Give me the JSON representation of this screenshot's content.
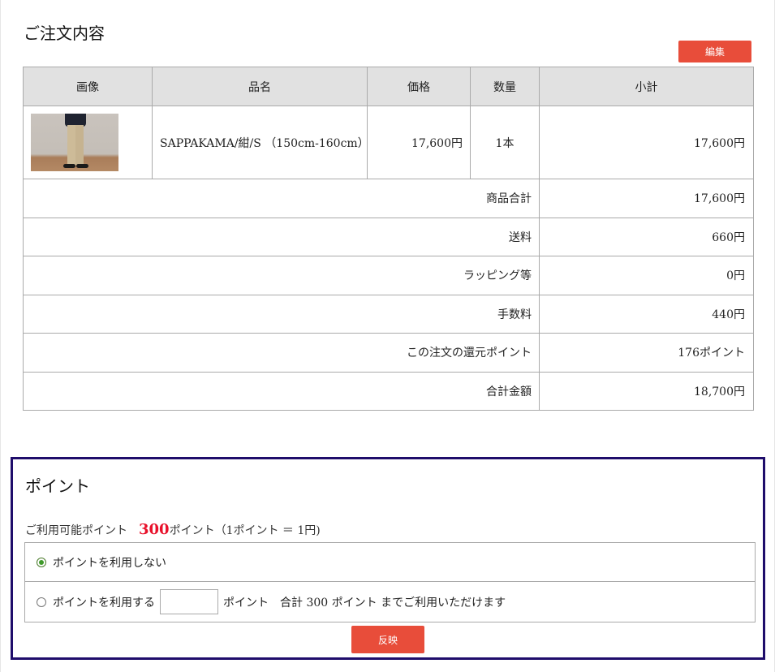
{
  "order": {
    "title": "ご注文内容",
    "edit_label": "編集",
    "headers": {
      "image": "画像",
      "name": "品名",
      "price": "価格",
      "qty": "数量",
      "subtotal": "小計"
    },
    "items": [
      {
        "name": "SAPPAKAMA/紺/S （150cm-160cm）",
        "price": "17,600円",
        "qty": "1本",
        "subtotal": "17,600円"
      }
    ],
    "summary": [
      {
        "label": "商品合計",
        "value": "17,600円"
      },
      {
        "label": "送料",
        "value": "660円"
      },
      {
        "label": "ラッピング等",
        "value": "0円"
      },
      {
        "label": "手数料",
        "value": "440円"
      },
      {
        "label": "この注文の還元ポイント",
        "value": "176ポイント"
      },
      {
        "label": "合計金額",
        "value": "18,700円"
      }
    ]
  },
  "points": {
    "title": "ポイント",
    "available_label": "ご利用可能ポイント",
    "available_value": "300",
    "available_unit": "ポイント（1ポイント ＝ 1円)",
    "option_none": "ポイントを利用しない",
    "option_use": "ポイントを利用する",
    "input_value": "",
    "use_suffix": "ポイント　合計 300 ポイント までご利用いただけます",
    "selected": "none",
    "apply_label": "反映"
  },
  "colors": {
    "accent": "#e84d3a",
    "points_border": "#1f0d6b",
    "point_number": "#e8102a"
  }
}
